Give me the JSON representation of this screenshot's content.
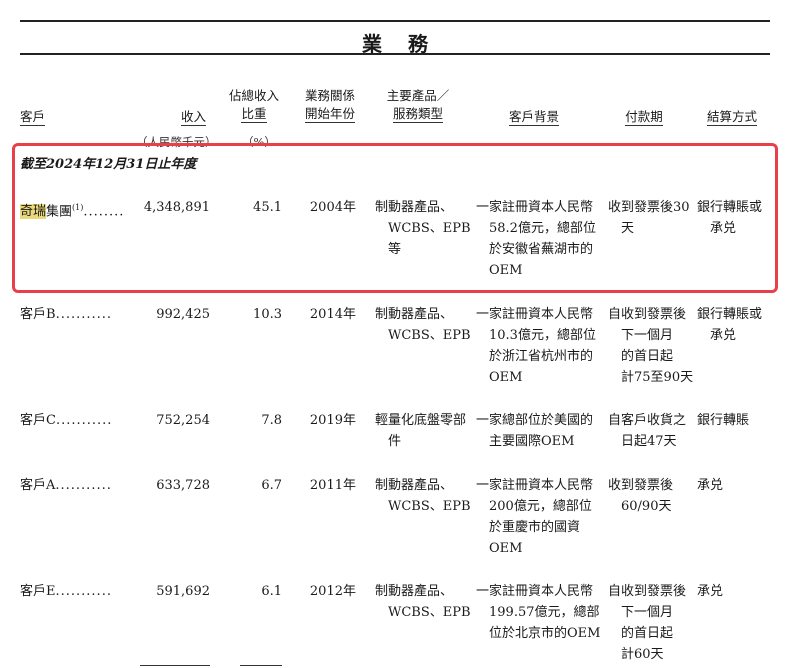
{
  "page": {
    "title": "業務"
  },
  "table": {
    "headers": {
      "customer": "客戶",
      "revenue": "收入",
      "share": [
        "佔總收入",
        "比重"
      ],
      "start_year": [
        "業務關係",
        "開始年份"
      ],
      "products": [
        "主要產品／",
        "服務類型"
      ],
      "background": "客戶背景",
      "payment_term": "付款期",
      "settlement": "結算方式"
    },
    "units": {
      "revenue": "（人民幣千元）",
      "share": "（%）"
    },
    "period": "截至2024年12月31日止年度",
    "rows": [
      {
        "name_highlight": "奇瑞",
        "name": "集團",
        "note": "(1)",
        "dots": "........",
        "revenue": "4,348,891",
        "share": "45.1",
        "year": "2004年",
        "products": [
          "制動器產品、",
          "WCBS、EPB",
          "等"
        ],
        "background": [
          "一家註冊資本人民幣",
          "58.2億元，總部位",
          "於安徽省蕪湖市的",
          "OEM"
        ],
        "payment": [
          "收到發票後30",
          "天"
        ],
        "settlement": [
          "銀行轉賬或",
          "承兑"
        ]
      },
      {
        "name_highlight": "",
        "name": "客戶B",
        "note": "",
        "dots": "...........",
        "revenue": "992,425",
        "share": "10.3",
        "year": "2014年",
        "products": [
          "制動器產品、",
          "WCBS、EPB"
        ],
        "background": [
          "一家註冊資本人民幣",
          "10.3億元，總部位",
          "於浙江省杭州市的",
          "OEM"
        ],
        "payment": [
          "自收到發票後",
          "下一個月",
          "的首日起",
          "計75至90天"
        ],
        "settlement": [
          "銀行轉賬或",
          "承兑"
        ]
      },
      {
        "name_highlight": "",
        "name": "客戶C",
        "note": "",
        "dots": "...........",
        "revenue": "752,254",
        "share": "7.8",
        "year": "2019年",
        "products": [
          "輕量化底盤零部",
          "件"
        ],
        "background": [
          "一家總部位於美國的",
          "主要國際OEM"
        ],
        "payment": [
          "自客戶收貨之",
          "日起47天"
        ],
        "settlement": [
          "銀行轉賬"
        ]
      },
      {
        "name_highlight": "",
        "name": "客戶A",
        "note": "",
        "dots": "...........",
        "revenue": "633,728",
        "share": "6.7",
        "year": "2011年",
        "products": [
          "制動器產品、",
          "WCBS、EPB"
        ],
        "background": [
          "一家註冊資本人民幣",
          "200億元，總部位",
          "於重慶市的國資",
          "OEM"
        ],
        "payment": [
          "收到發票後",
          "60/90天"
        ],
        "settlement": [
          "承兑"
        ]
      },
      {
        "name_highlight": "",
        "name": "客戶E",
        "note": "",
        "dots": "...........",
        "revenue": "591,692",
        "share": "6.1",
        "year": "2012年",
        "products": [
          "制動器產品、",
          "WCBS、EPB"
        ],
        "background": [
          "一家註冊資本人民幣",
          "199.57億元，總部",
          "位於北京市的OEM"
        ],
        "payment": [
          "自收到發票後",
          "下一個月",
          "的首日起",
          "計60天"
        ],
        "settlement": [
          "承兑"
        ]
      }
    ]
  },
  "colors": {
    "highlight_box": "#e8404b",
    "name_highlight": "#e9d97c"
  }
}
